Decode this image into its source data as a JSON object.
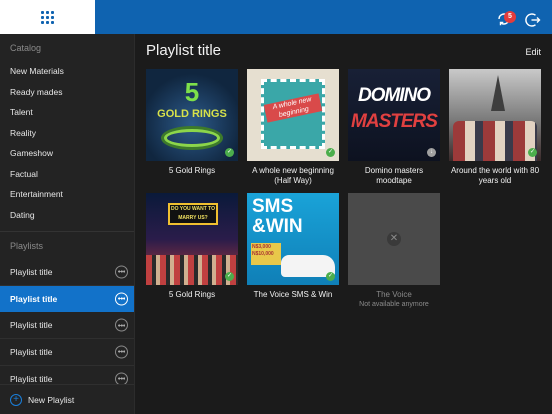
{
  "header": {
    "sync_badge_count": "5",
    "icons": [
      "grid-logo-icon",
      "sync-icon",
      "logout-icon"
    ],
    "accent_color": "#0f63b0"
  },
  "sidebar": {
    "catalog_header": "Catalog",
    "catalog_items": [
      {
        "label": "New Materials"
      },
      {
        "label": "Ready mades"
      },
      {
        "label": "Talent"
      },
      {
        "label": "Reality"
      },
      {
        "label": "Gameshow"
      },
      {
        "label": "Factual"
      },
      {
        "label": "Entertainment"
      },
      {
        "label": "Dating"
      }
    ],
    "playlists_header": "Playlists",
    "playlists": [
      {
        "label": "Playlist title"
      },
      {
        "label": "Playlist title",
        "active": true
      },
      {
        "label": "Playlist title"
      },
      {
        "label": "Playlist title"
      },
      {
        "label": "Playlist title"
      }
    ],
    "new_playlist_label": "New Playlist",
    "active_color": "#1272c9"
  },
  "main": {
    "title": "Playlist title",
    "edit_label": "Edit",
    "items": [
      {
        "title": "5 Gold Rings",
        "thumb_text": [
          "5",
          "GOLD RINGS"
        ],
        "status": "check"
      },
      {
        "title": "A whole new beginning (Half Way)",
        "thumb_text": [
          "A whole new beginning"
        ],
        "status": "check"
      },
      {
        "title": "Domino masters moodtape",
        "thumb_text": [
          "DOMINO",
          "MASTERS"
        ],
        "status": "grey-check"
      },
      {
        "title": "Around the world with 80 years old",
        "thumb_text": [],
        "status": "check"
      },
      {
        "title": "5 Gold Rings",
        "thumb_text": [
          "DO YOU WANT TO MARRY US?"
        ],
        "status": "check"
      },
      {
        "title": "The Voice SMS & Win",
        "thumb_text": [
          "SMS",
          "&WIN",
          "N$3,000",
          "N$10,000"
        ],
        "status": "check"
      },
      {
        "title": "The Voice",
        "subtitle": "Not available anymore",
        "status": "unavailable"
      }
    ],
    "check_color": "#4cae4c"
  }
}
